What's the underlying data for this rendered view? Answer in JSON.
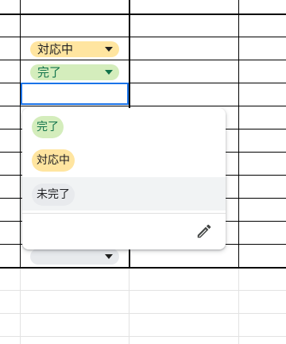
{
  "sheet": {
    "chips": [
      {
        "label": "対応中",
        "color": "#ffe5a0"
      },
      {
        "label": "完了",
        "color": "#d4edbc"
      },
      {
        "label": "",
        "color": "#e8eaed"
      }
    ]
  },
  "dropdown": {
    "options": [
      {
        "label": "完了",
        "color": "#d4edbc"
      },
      {
        "label": "対応中",
        "color": "#ffe5a0"
      },
      {
        "label": "未完了",
        "color": "#e8eaed"
      }
    ],
    "edit_icon": "pencil-icon"
  }
}
